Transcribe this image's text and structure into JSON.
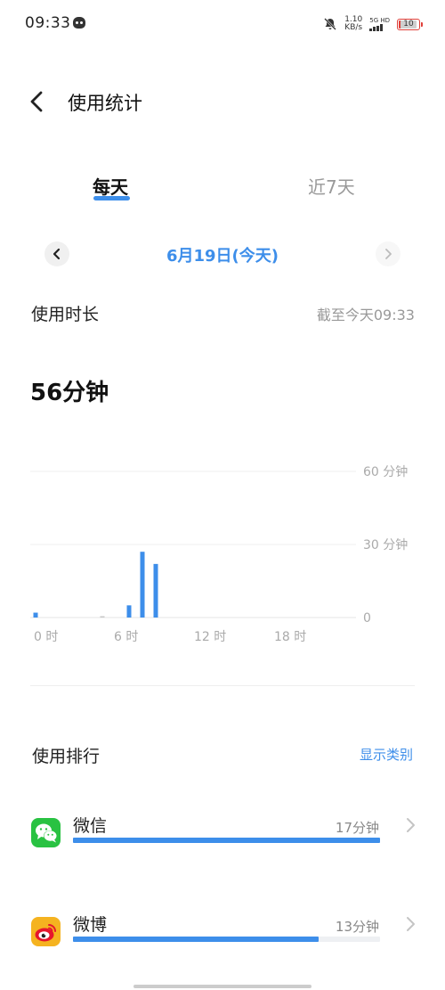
{
  "status_bar": {
    "time": "09:33",
    "net_speed_value": "1.10",
    "net_speed_unit": "KB/s",
    "network_label": "5G HD",
    "battery_level": "10"
  },
  "header": {
    "title": "使用统计"
  },
  "tabs": [
    {
      "label": "每天",
      "selected": true
    },
    {
      "label": "近7天",
      "selected": false
    }
  ],
  "date_nav": {
    "date_label": "6月19日(今天)"
  },
  "usage": {
    "title": "使用时长",
    "until": "截至今天09:33",
    "total": "56分钟"
  },
  "chart_data": {
    "type": "bar",
    "x_unit": "hour",
    "x_ticks": [
      "0 时",
      "6 时",
      "12 时",
      "18 时"
    ],
    "y_ticks": [
      "0",
      "30 分钟",
      "60 分钟"
    ],
    "ylim": [
      0,
      60
    ],
    "grid": true,
    "bar_color": "#3d8eea",
    "bars": [
      {
        "hour": 0,
        "minutes": 2
      },
      {
        "hour": 5,
        "minutes": 0.5
      },
      {
        "hour": 7,
        "minutes": 5
      },
      {
        "hour": 8,
        "minutes": 27
      },
      {
        "hour": 9,
        "minutes": 22
      }
    ]
  },
  "ranking": {
    "title": "使用排行",
    "show_category": "显示类别",
    "apps": [
      {
        "name": "微信",
        "duration": "17分钟",
        "fraction": 1.0,
        "icon": "wechat-icon",
        "icon_color": "#29c242"
      },
      {
        "name": "微博",
        "duration": "13分钟",
        "fraction": 0.799,
        "icon": "weibo-icon",
        "icon_color": "#f5b320"
      }
    ]
  },
  "colors": {
    "accent": "#3d8eea",
    "battery_low": "#e0403a"
  }
}
